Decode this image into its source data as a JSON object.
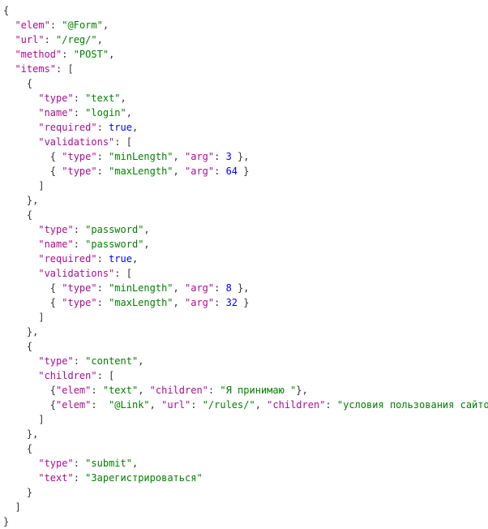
{
  "code": {
    "keys": {
      "elem": "\"elem\"",
      "url": "\"url\"",
      "method": "\"method\"",
      "items": "\"items\"",
      "type": "\"type\"",
      "name": "\"name\"",
      "required": "\"required\"",
      "validations": "\"validations\"",
      "arg": "\"arg\"",
      "children": "\"children\"",
      "text": "\"text\""
    },
    "strings": {
      "form": "\"@Form\"",
      "reg": "\"/reg/\"",
      "post": "\"POST\"",
      "t_text": "\"text\"",
      "login": "\"login\"",
      "minLength": "\"minLength\"",
      "maxLength": "\"maxLength\"",
      "t_password": "\"password\"",
      "password": "\"password\"",
      "t_content": "\"content\"",
      "elem_text": "\"text\"",
      "accept": "\"Я принимаю \"",
      "link": "\"@Link\"",
      "rules": "\"/rules/\"",
      "terms": "\"условия пользования сайтом\"",
      "t_submit": "\"submit\"",
      "register": "\"Зарегистрироваться\""
    },
    "booleans": {
      "true1": "true",
      "true2": "true"
    },
    "numbers": {
      "n3": "3",
      "n64": "64",
      "n8": "8",
      "n32": "32"
    }
  }
}
